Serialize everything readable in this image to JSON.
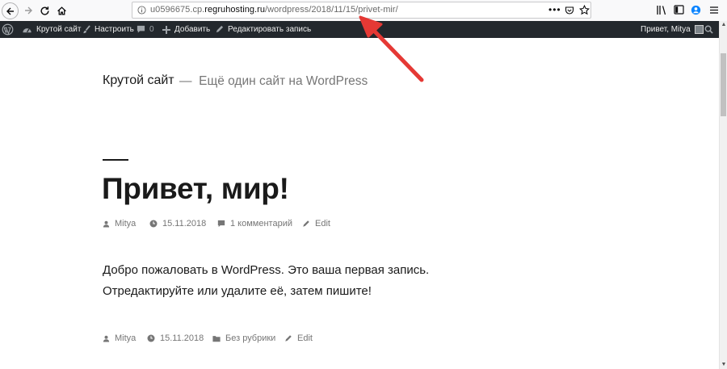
{
  "browser": {
    "url_prefix": "u0596675.cp.",
    "url_domain": "regruhosting.ru",
    "url_path": "/wordpress/2018/11/15/privet-mir/"
  },
  "adminbar": {
    "site_name": "Крутой сайт",
    "customize": "Настроить",
    "comments_count": "0",
    "add_new": "Добавить",
    "edit_post": "Редактировать запись",
    "greeting": "Привет, Mitya"
  },
  "site": {
    "title": "Крутой сайт",
    "separator": "—",
    "description": "Ещё один сайт на WordPress"
  },
  "post": {
    "title": "Привет, мир!",
    "author": "Mitya",
    "date": "15.11.2018",
    "comments": "1 комментарий",
    "edit": "Edit",
    "content_line1": "Добро пожаловать в WordPress. Это ваша первая запись.",
    "content_line2": "Отредактируйте или удалите её, затем пишите!",
    "footer_author": "Mitya",
    "footer_date": "15.11.2018",
    "footer_category": "Без рубрики",
    "footer_edit": "Edit"
  },
  "colors": {
    "adminbar_bg": "#23282d",
    "annotation_arrow": "#e53935",
    "muted_text": "#767676"
  }
}
